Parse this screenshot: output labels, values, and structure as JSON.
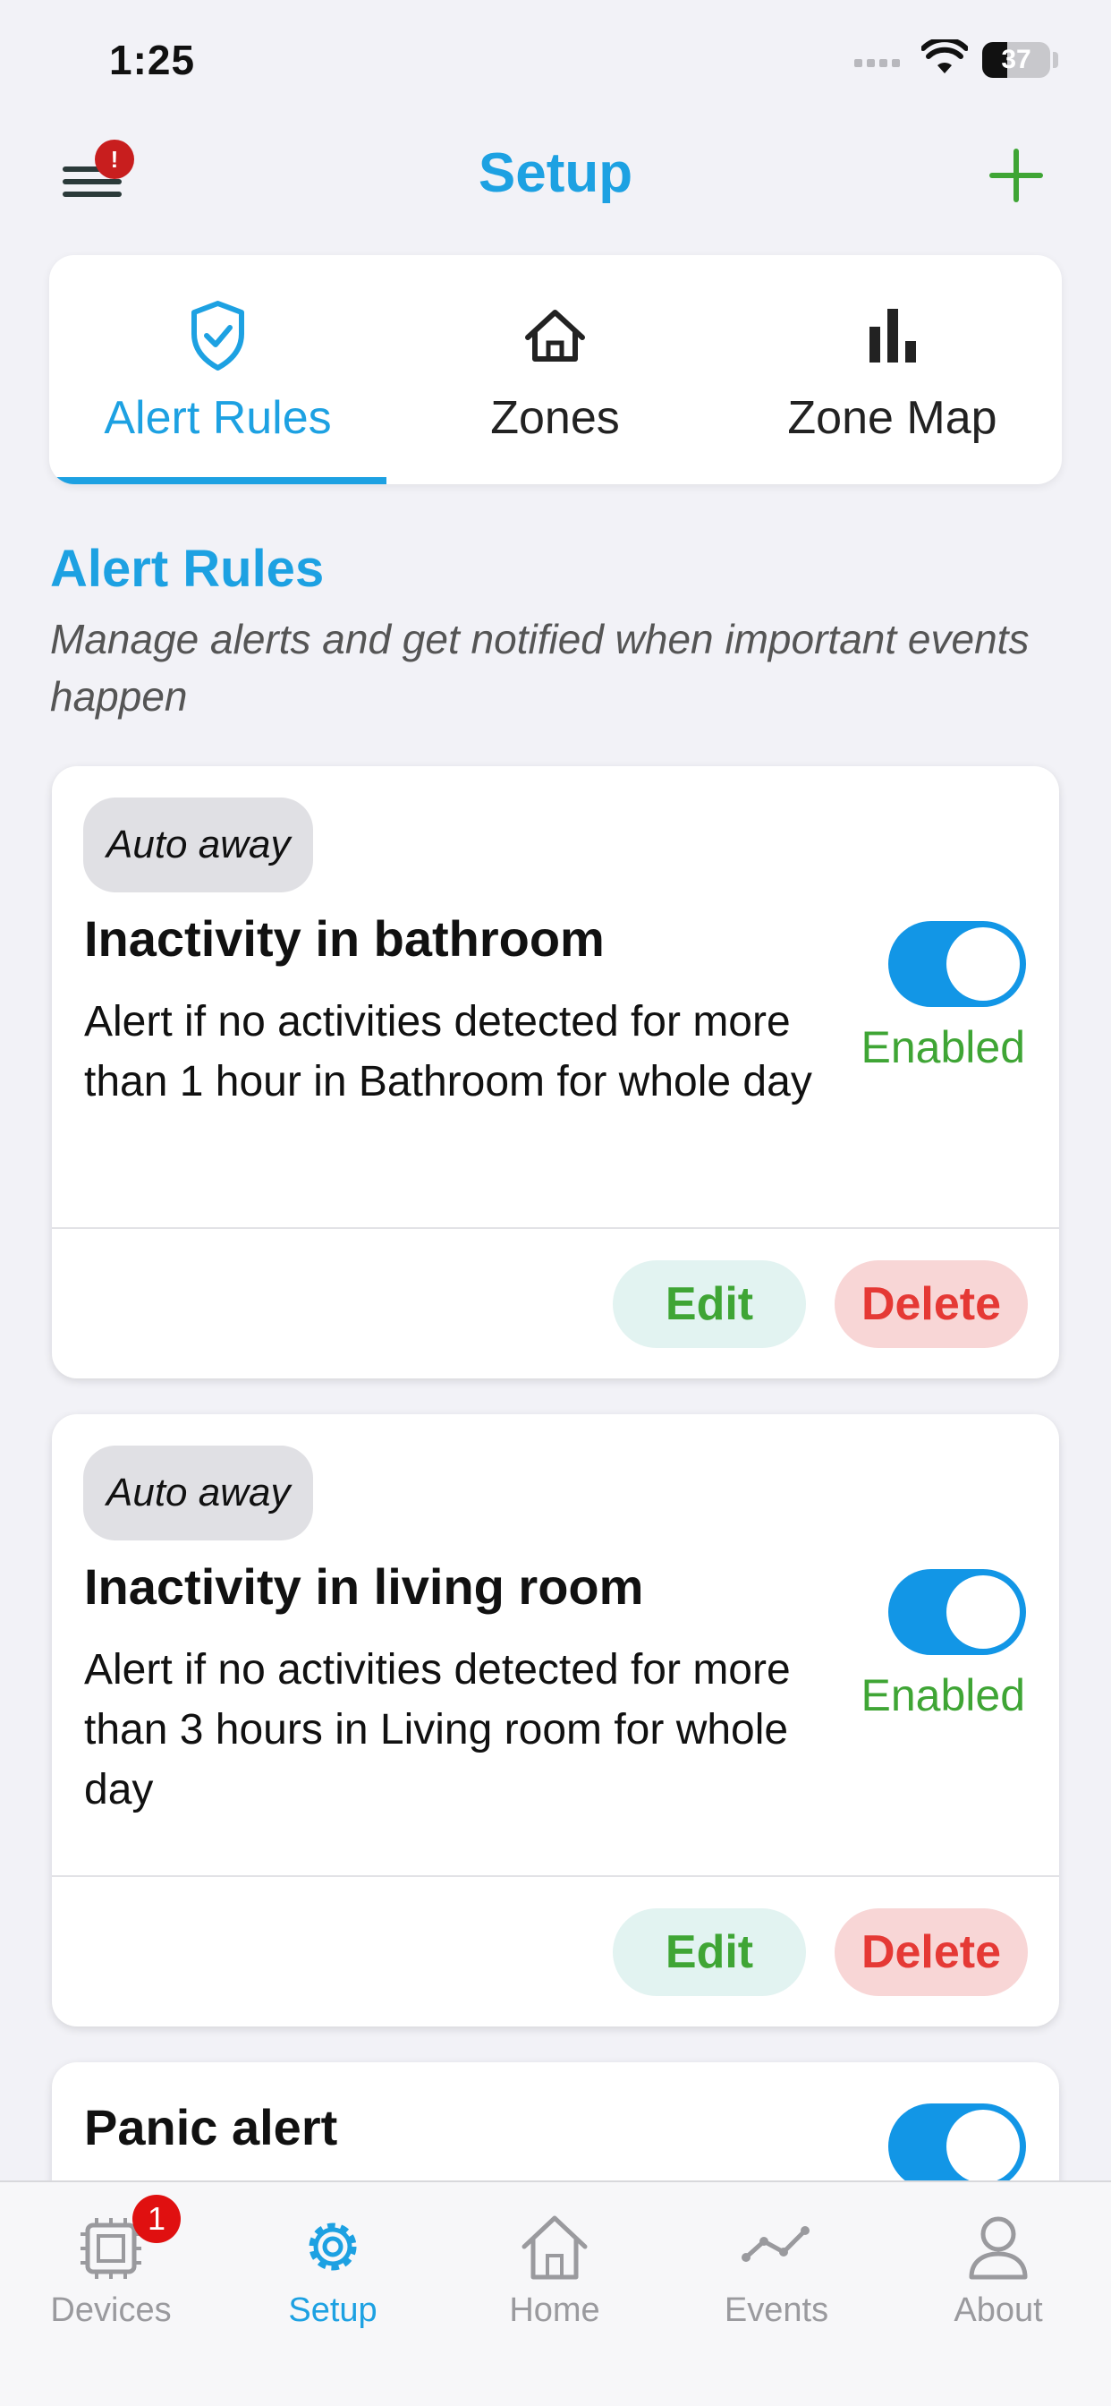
{
  "status_bar": {
    "time": "1:25",
    "battery": "37"
  },
  "header": {
    "title": "Setup",
    "menu_badge": "!"
  },
  "tabs": [
    {
      "label": "Alert Rules",
      "icon": "shield-check-icon",
      "active": true
    },
    {
      "label": "Zones",
      "icon": "home-icon",
      "active": false
    },
    {
      "label": "Zone Map",
      "icon": "bar-chart-icon",
      "active": false
    }
  ],
  "section": {
    "title": "Alert Rules",
    "subtitle": "Manage alerts and get notified when important events happen"
  },
  "rules": [
    {
      "tag": "Auto away",
      "title": "Inactivity in bathroom",
      "description": "Alert if no activities detected for more than 1 hour in Bathroom for whole day",
      "state": "Enabled",
      "edit_label": "Edit",
      "delete_label": "Delete"
    },
    {
      "tag": "Auto away",
      "title": "Inactivity in living room",
      "description": "Alert if no activities detected for more than 3 hours in Living room for whole day",
      "state": "Enabled",
      "edit_label": "Edit",
      "delete_label": "Delete"
    },
    {
      "title": "Panic alert"
    }
  ],
  "bottom_nav": [
    {
      "label": "Devices",
      "icon": "chip-icon",
      "badge": "1"
    },
    {
      "label": "Setup",
      "icon": "gear-icon",
      "active": true
    },
    {
      "label": "Home",
      "icon": "home-icon"
    },
    {
      "label": "Events",
      "icon": "trend-line-icon"
    },
    {
      "label": "About",
      "icon": "user-icon"
    }
  ],
  "colors": {
    "accent": "#1da1e2",
    "enabled_green": "#3fa535",
    "delete_red": "#e53935",
    "toggle_on": "#1296e6"
  }
}
